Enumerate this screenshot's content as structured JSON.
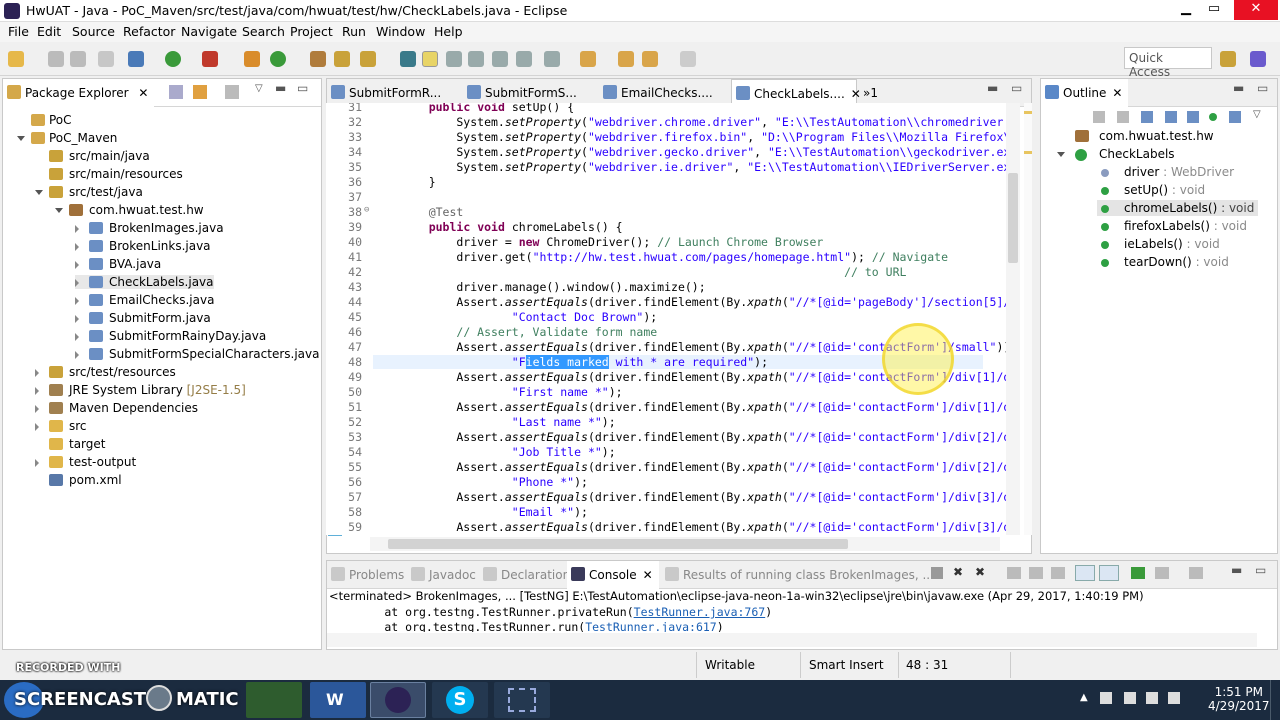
{
  "window": {
    "title": "HwUAT - Java - PoC_Maven/src/test/java/com/hwuat/test/hw/CheckLabels.java - Eclipse",
    "min": "▁",
    "max": "▭",
    "close": "✕"
  },
  "menu": [
    "File",
    "Edit",
    "Source",
    "Refactor",
    "Navigate",
    "Search",
    "Project",
    "Run",
    "Window",
    "Help"
  ],
  "quick_access": "Quick Access",
  "package_explorer": {
    "title": "Package Explorer",
    "items": [
      {
        "label": "PoC",
        "extra": ""
      },
      {
        "label": "PoC_Maven",
        "extra": ""
      },
      {
        "label": "src/main/java",
        "extra": ""
      },
      {
        "label": "src/main/resources",
        "extra": ""
      },
      {
        "label": "src/test/java",
        "extra": ""
      },
      {
        "label": "com.hwuat.test.hw",
        "extra": ""
      },
      {
        "label": "BrokenImages.java",
        "extra": ""
      },
      {
        "label": "BrokenLinks.java",
        "extra": ""
      },
      {
        "label": "BVA.java",
        "extra": ""
      },
      {
        "label": "CheckLabels.java",
        "extra": ""
      },
      {
        "label": "EmailChecks.java",
        "extra": ""
      },
      {
        "label": "SubmitForm.java",
        "extra": ""
      },
      {
        "label": "SubmitFormRainyDay.java",
        "extra": ""
      },
      {
        "label": "SubmitFormSpecialCharacters.java",
        "extra": ""
      },
      {
        "label": "src/test/resources",
        "extra": ""
      },
      {
        "label": "JRE System Library",
        "extra": "[J2SE-1.5]"
      },
      {
        "label": "Maven Dependencies",
        "extra": ""
      },
      {
        "label": "src",
        "extra": ""
      },
      {
        "label": "target",
        "extra": ""
      },
      {
        "label": "test-output",
        "extra": ""
      },
      {
        "label": "pom.xml",
        "extra": ""
      }
    ]
  },
  "editor_tabs": [
    "SubmitFormR...",
    "SubmitFormS...",
    "EmailChecks....",
    "CheckLabels....",
    "»1"
  ],
  "code_lines": [
    {
      "n": "31",
      "t": "    public void setUp() {"
    },
    {
      "n": "32",
      "t": "        System.setProperty(\"webdriver.chrome.driver\", \"E:\\\\TestAutomation\\\\chromedriver.ex"
    },
    {
      "n": "33",
      "t": "        System.setProperty(\"webdriver.firefox.bin\", \"D:\\\\Program Files\\\\Mozilla Firefox\\\\f"
    },
    {
      "n": "34",
      "t": "        System.setProperty(\"webdriver.gecko.driver\", \"E:\\\\TestAutomation\\\\geckodriver.exe"
    },
    {
      "n": "35",
      "t": "        System.setProperty(\"webdriver.ie.driver\", \"E:\\\\TestAutomation\\\\IEDriverServer.exe\""
    },
    {
      "n": "36",
      "t": "    }"
    },
    {
      "n": "37",
      "t": ""
    },
    {
      "n": "38",
      "t": "    @Test"
    },
    {
      "n": "39",
      "t": "    public void chromeLabels() {"
    },
    {
      "n": "40",
      "t": "        driver = new ChromeDriver(); // Launch Chrome Browser"
    },
    {
      "n": "41",
      "t": "        driver.get(\"http://hw.test.hwuat.com/pages/homepage.html\"); // Navigate"
    },
    {
      "n": "42",
      "t": "                                                                // to URL"
    },
    {
      "n": "43",
      "t": "        driver.manage().window().maximize();"
    },
    {
      "n": "44",
      "t": "        Assert.assertEquals(driver.findElement(By.xpath(\"//*[@id='pageBody']/section[5]/di"
    },
    {
      "n": "45",
      "t": "                \"Contact Doc Brown\");"
    },
    {
      "n": "46",
      "t": "        // Assert, Validate form name"
    },
    {
      "n": "47",
      "t": "        Assert.assertEquals(driver.findElement(By.xpath(\"//*[@id='contactForm']/small\")).g"
    },
    {
      "n": "48",
      "t": "                \"Fields marked with * are required\");"
    },
    {
      "n": "49",
      "t": "        Assert.assertEquals(driver.findElement(By.xpath(\"//*[@id='contactForm']/div[1]/div"
    },
    {
      "n": "50",
      "t": "                \"First name *\");"
    },
    {
      "n": "51",
      "t": "        Assert.assertEquals(driver.findElement(By.xpath(\"//*[@id='contactForm']/div[1]/div"
    },
    {
      "n": "52",
      "t": "                \"Last name *\");"
    },
    {
      "n": "53",
      "t": "        Assert.assertEquals(driver.findElement(By.xpath(\"//*[@id='contactForm']/div[2]/div"
    },
    {
      "n": "54",
      "t": "                \"Job Title *\");"
    },
    {
      "n": "55",
      "t": "        Assert.assertEquals(driver.findElement(By.xpath(\"//*[@id='contactForm']/div[2]/div"
    },
    {
      "n": "56",
      "t": "                \"Phone *\");"
    },
    {
      "n": "57",
      "t": "        Assert.assertEquals(driver.findElement(By.xpath(\"//*[@id='contactForm']/div[3]/div"
    },
    {
      "n": "58",
      "t": "                \"Email *\");"
    },
    {
      "n": "59",
      "t": "        Assert.assertEquals(driver.findElement(By.xpath(\"//*[@id='contactForm']/div[3]/div"
    }
  ],
  "outline": {
    "title": "Outline",
    "items": [
      {
        "label": "com.hwuat.test.hw",
        "type": ""
      },
      {
        "label": "CheckLabels",
        "type": ""
      },
      {
        "label": "driver",
        "type": " : WebDriver"
      },
      {
        "label": "setUp()",
        "type": " : void"
      },
      {
        "label": "chromeLabels()",
        "type": " : void"
      },
      {
        "label": "firefoxLabels()",
        "type": " : void"
      },
      {
        "label": "ieLabels()",
        "type": " : void"
      },
      {
        "label": "tearDown()",
        "type": " : void"
      }
    ]
  },
  "bottom_tabs": [
    "Problems",
    "Javadoc",
    "Declaration",
    "Console",
    "Results of running class BrokenImages, ..."
  ],
  "console": {
    "header": "<terminated> BrokenImages, ... [TestNG] E:\\TestAutomation\\eclipse-java-neon-1a-win32\\eclipse\\jre\\bin\\javaw.exe (Apr 29, 2017, 1:40:19 PM)",
    "lines": [
      {
        "pre": "        at org.testng.TestRunner.privateRun(",
        "link": "TestRunner.java:767",
        "post": ")"
      },
      {
        "pre": "        at org.testng.TestRunner.run(",
        "link": "TestRunner.java:617",
        "post": ")"
      }
    ]
  },
  "status": {
    "writable": "Writable",
    "insert": "Smart Insert",
    "pos": "48 : 31"
  },
  "watermark": "RECORDED WITH",
  "screencast": "SCREENCAST",
  "matic": "MATIC",
  "clock": {
    "time": "1:51 PM",
    "date": "4/29/2017"
  },
  "colors": {
    "keyword": "#7f0055",
    "string": "#2a00ff",
    "comment": "#3f7f5f",
    "selection": "#3399ff",
    "taskbar": "#1b2b3f"
  }
}
